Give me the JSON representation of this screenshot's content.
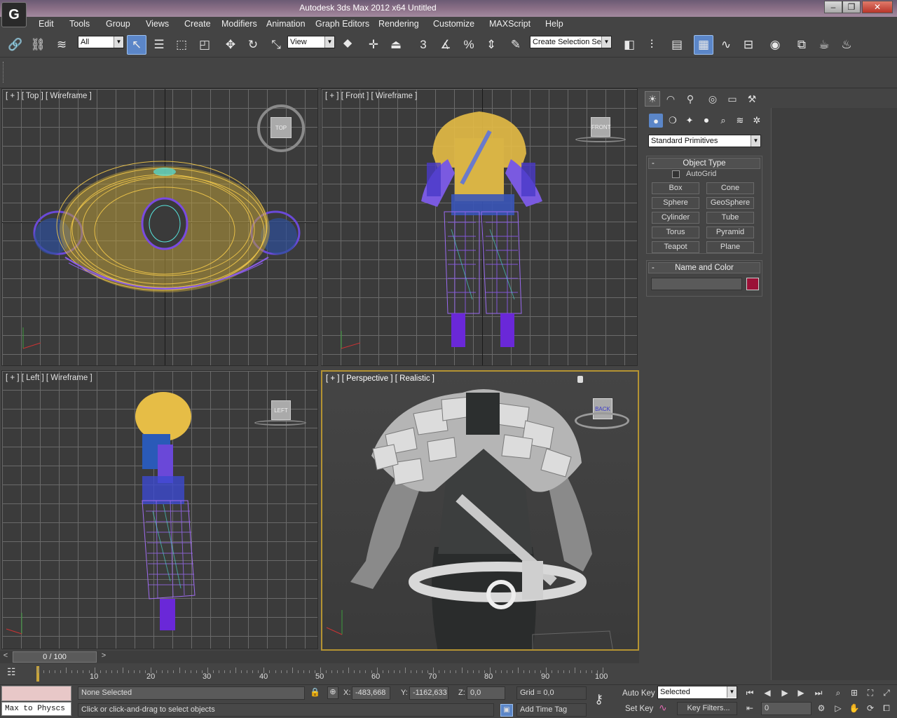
{
  "window": {
    "title": "Autodesk 3ds Max  2012 x64     Untitled",
    "minimize": "–",
    "restore": "❐",
    "close": "✕"
  },
  "menu": [
    "Edit",
    "Tools",
    "Group",
    "Views",
    "Create",
    "Modifiers",
    "Animation",
    "Graph Editors",
    "Rendering",
    "Customize",
    "MAXScript",
    "Help"
  ],
  "toolbar": {
    "selection_filter": "All",
    "reference_coord": "View",
    "named_selection": "Create Selection Se",
    "snap_3": "3",
    "snap_percent": "%"
  },
  "viewports": {
    "top": {
      "label": "[ + ] [ Top ] [ Wireframe ]",
      "cube": "TOP"
    },
    "front": {
      "label": "[ + ] [ Front ] [ Wireframe ]",
      "cube": "FRONT"
    },
    "left": {
      "label": "[ + ] [ Left ] [ Wireframe ]",
      "cube": "LEFT"
    },
    "perspective": {
      "label": "[ + ] [ Perspective ] [ Realistic ]",
      "cube": "BACK"
    }
  },
  "command_panel": {
    "category": "Standard Primitives",
    "object_type_title": "Object Type",
    "autogrid": "AutoGrid",
    "buttons": [
      "Box",
      "Cone",
      "Sphere",
      "GeoSphere",
      "Cylinder",
      "Tube",
      "Torus",
      "Pyramid",
      "Teapot",
      "Plane"
    ],
    "name_color_title": "Name and Color",
    "name_value": "",
    "color": "#9b1137"
  },
  "timeline": {
    "frame_display": "0 / 100",
    "ticks": [
      "10",
      "20",
      "30",
      "40",
      "50",
      "60",
      "70",
      "80",
      "90",
      "100"
    ]
  },
  "status": {
    "script_listener": "Max to Physcs",
    "selection_info": "None Selected",
    "prompt": "Click or click-and-drag to select objects",
    "x_label": "X:",
    "x_value": "-483,668",
    "y_label": "Y:",
    "y_value": "-1162,633",
    "z_label": "Z:",
    "z_value": "0,0",
    "grid": "Grid = 0,0",
    "add_time_tag": "Add Time Tag",
    "auto_key": "Auto Key",
    "set_key": "Set Key",
    "key_mode": "Selected",
    "key_filters": "Key Filters...",
    "frame_value": "0"
  }
}
